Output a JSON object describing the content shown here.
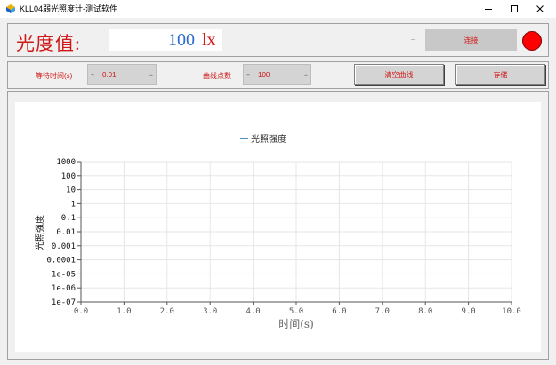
{
  "window": {
    "title": "KLL04弱光照度计-测试软件",
    "app_icon": "app-icon",
    "controls": [
      "minimize-icon",
      "maximize-icon",
      "close-icon"
    ]
  },
  "reading": {
    "label": "光度值:",
    "value": "100",
    "unit": "lx"
  },
  "connection": {
    "connect_label": "连接",
    "status_color": "#ff0000"
  },
  "settings": {
    "wait_time_label": "等待时间(s)",
    "wait_time_value": "0.01",
    "curve_points_label": "曲线点数",
    "curve_points_value": "100",
    "clear_label": "清空曲线",
    "save_label": "存储"
  },
  "colors": {
    "accent_red": "#d01818",
    "value_blue": "#2a6bd0",
    "series_line": "#1f77b4"
  },
  "chart_data": {
    "type": "line",
    "title": "",
    "xlabel": "时间(s)",
    "ylabel": "光照强度",
    "xlim": [
      0.0,
      10.0
    ],
    "ylim": [
      1e-07,
      1000
    ],
    "yscale": "log",
    "grid": true,
    "legend_position": "top-center",
    "x_ticks": [
      "0.0",
      "1.0",
      "2.0",
      "3.0",
      "4.0",
      "5.0",
      "6.0",
      "7.0",
      "8.0",
      "9.0",
      "10.0"
    ],
    "y_ticks": [
      "1e-07",
      "1e-06",
      "1e-05",
      "0.0001",
      "0.001",
      "0.01",
      "0.1",
      "1",
      "10",
      "100",
      "1000"
    ],
    "series": [
      {
        "name": "光照强度",
        "x": [],
        "y": []
      }
    ]
  }
}
